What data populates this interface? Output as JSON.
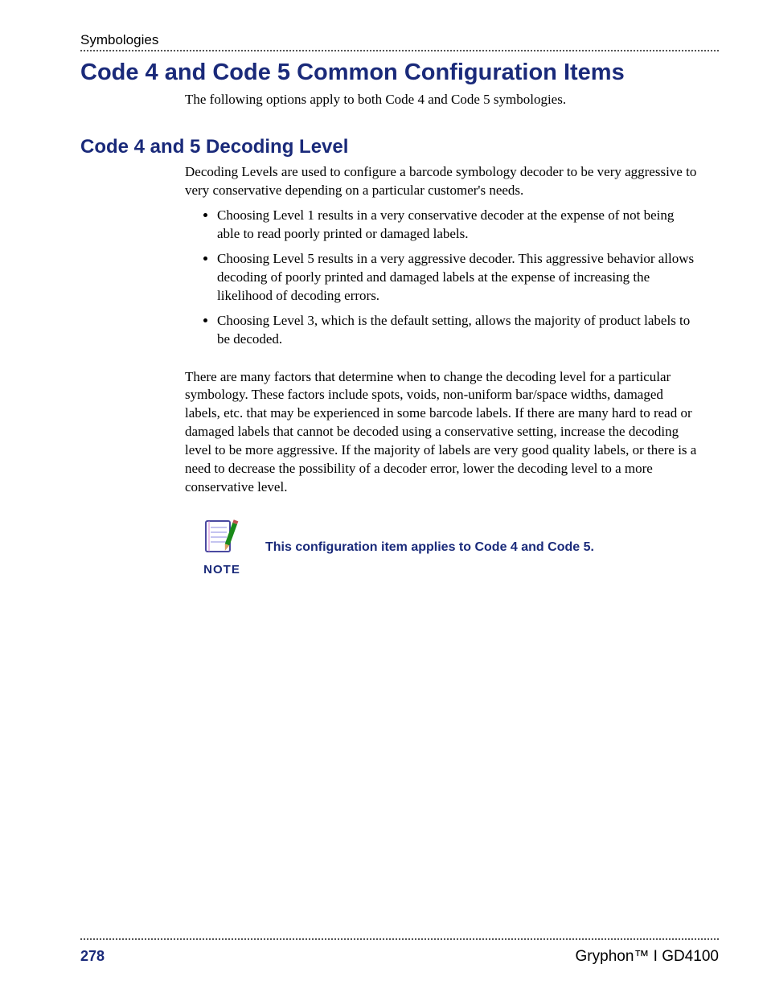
{
  "header": {
    "section": "Symbologies"
  },
  "h1": "Code 4 and Code 5 Common Configuration Items",
  "intro": "The following options apply to both Code 4 and Code 5 symbologies.",
  "h2": "Code 4 and 5 Decoding Level",
  "decoding_intro": "Decoding Levels are used to configure a barcode symbology decoder to be very aggressive to very conservative depending on a particular customer's needs.",
  "bullets": {
    "b0": "Choosing Level 1 results in a very conservative decoder at the expense of not being able to read poorly printed or damaged labels.",
    "b1": "Choosing Level 5 results in a very aggressive decoder. This aggressive behavior allows decoding of poorly printed and damaged labels at the expense of increasing the likelihood of decoding errors.",
    "b2": "Choosing Level 3, which is the default setting, allows the majority of product labels to be decoded."
  },
  "factors": "There are many factors that determine when to change the decoding level for a particular symbology. These factors include spots, voids, non-uniform bar/space widths, damaged labels, etc. that may be experienced in some barcode labels. If there are many hard to read or damaged labels that cannot be decoded using a conservative setting, increase the decoding level to be more aggressive. If the majority of labels are very good quality labels, or there is a need to decrease the possibility of a decoder error, lower the decoding level to a more conservative level.",
  "note": {
    "label": "NOTE",
    "text": "This configuration item applies to Code 4 and Code 5."
  },
  "footer": {
    "page": "278",
    "product": "Gryphon™ I GD4100"
  }
}
